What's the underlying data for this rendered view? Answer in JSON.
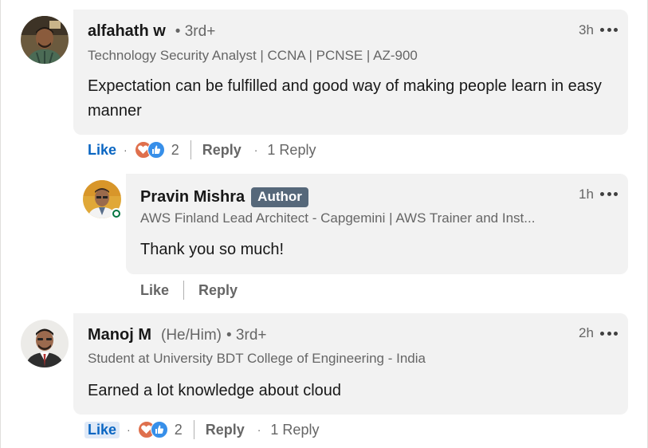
{
  "comments": [
    {
      "author": "alfahath w",
      "degree": "• 3rd+",
      "headline": "Technology Security Analyst | CCNA | PCNSE | AZ-900",
      "text": "Expectation can be fulfilled and good way of making people learn in easy manner",
      "time": "3h",
      "like_label": "Like",
      "reaction_count": "2",
      "reply_label": "Reply",
      "reply_count": "1 Reply"
    },
    {
      "author": "Pravin Mishra",
      "badge": "Author",
      "headline": "AWS Finland Lead Architect - Capgemini | AWS Trainer and Inst...",
      "text": "Thank you so much!",
      "time": "1h",
      "like_label": "Like",
      "reply_label": "Reply"
    },
    {
      "author": "Manoj M",
      "pronouns": "(He/Him)",
      "degree": "• 3rd+",
      "headline": "Student at University BDT College of Engineering - India",
      "text": "Earned a lot knowledge about cloud",
      "time": "2h",
      "like_label": "Like",
      "reaction_count": "2",
      "reply_label": "Reply",
      "reply_count": "1 Reply"
    }
  ],
  "icons": {
    "more": "more-options-icon",
    "love": "love-reaction-icon",
    "like": "like-reaction-icon",
    "online": "online-status-icon"
  },
  "colors": {
    "link_blue": "#0a66c2",
    "bubble_bg": "#f2f2f2",
    "author_badge": "#56687a",
    "love": "#df704d",
    "like": "#378fe9",
    "online": "#057642"
  }
}
